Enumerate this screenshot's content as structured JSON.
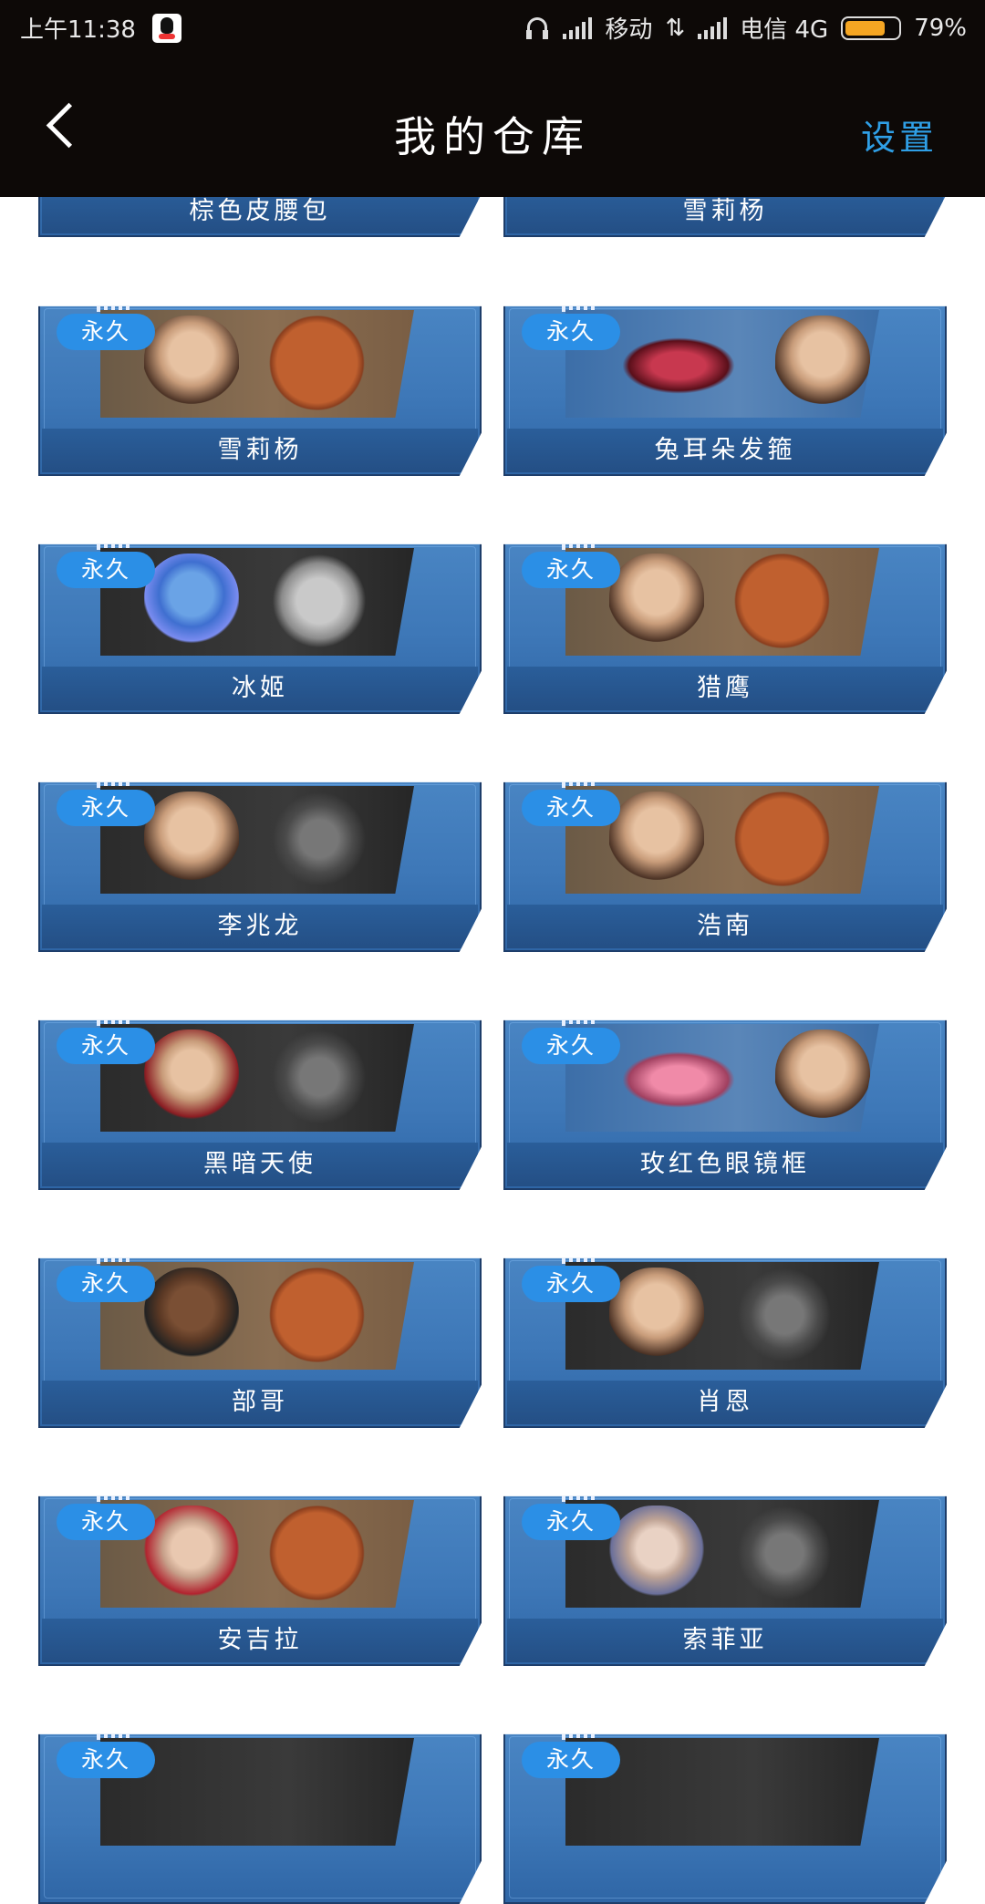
{
  "status_bar": {
    "time": "上午11:38",
    "carrier1": "移动",
    "carrier2": "电信 4G",
    "battery": "79%",
    "battery_level": 0.79
  },
  "header": {
    "title": "我的仓库",
    "settings_label": "设置"
  },
  "cards": [
    {
      "name": "棕色皮腰包",
      "tag": ""
    },
    {
      "name": "雪莉杨",
      "tag": ""
    },
    {
      "name": "雪莉杨",
      "tag": "永久"
    },
    {
      "name": "兔耳朵发箍",
      "tag": "永久"
    },
    {
      "name": "冰姬",
      "tag": "永久"
    },
    {
      "name": "猎鹰",
      "tag": "永久"
    },
    {
      "name": "李兆龙",
      "tag": "永久"
    },
    {
      "name": "浩南",
      "tag": "永久"
    },
    {
      "name": "黑暗天使",
      "tag": "永久"
    },
    {
      "name": "玫红色眼镜框",
      "tag": "永久"
    },
    {
      "name": "部哥",
      "tag": "永久"
    },
    {
      "name": "肖恩",
      "tag": "永久"
    },
    {
      "name": "安吉拉",
      "tag": "永久"
    },
    {
      "name": "索菲亚",
      "tag": "永久"
    },
    {
      "name": "",
      "tag": "永久"
    },
    {
      "name": "",
      "tag": "永久"
    }
  ]
}
